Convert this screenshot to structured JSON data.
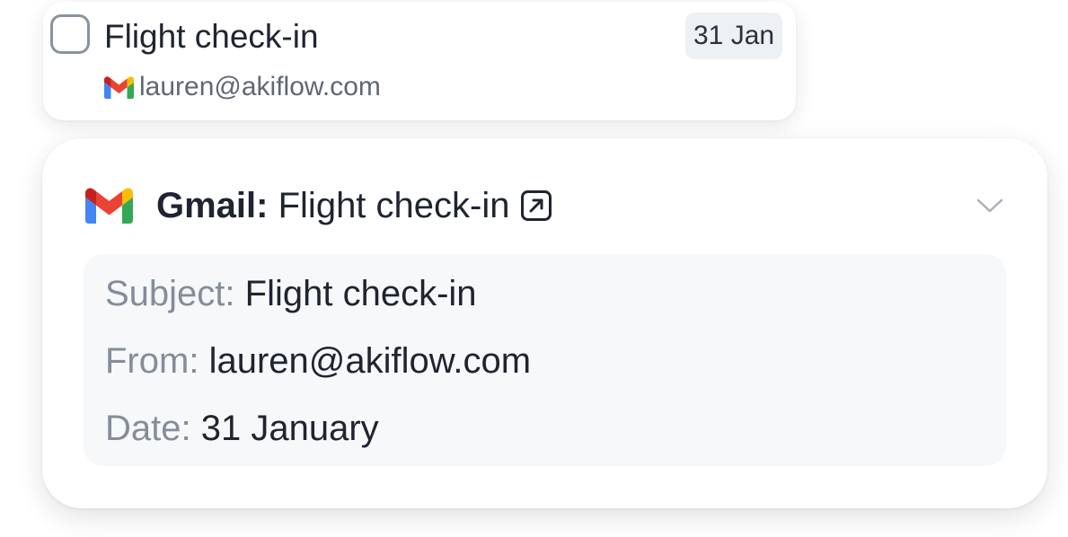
{
  "task": {
    "title": "Flight check-in",
    "date_badge": "31 Jan",
    "source_email": "lauren@akiflow.com",
    "source_icon": "gmail-icon"
  },
  "detail": {
    "provider": "Gmail:",
    "title": "Flight check-in",
    "open_icon": "external-link-icon",
    "collapse_icon": "chevron-down-icon",
    "fields": {
      "subject_label": "Subject:",
      "subject_value": "Flight check-in",
      "from_label": "From:",
      "from_value": "lauren@akiflow.com",
      "date_label": "Date:",
      "date_value": "31 January"
    }
  },
  "colors": {
    "gmail_red": "#EA4335",
    "gmail_blue": "#4285F4",
    "gmail_green": "#34A853",
    "gmail_yellow": "#FBBC04",
    "gmail_dark_red": "#C5221F",
    "badge_bg": "#EEF1F4",
    "label_gray": "#848D99"
  }
}
